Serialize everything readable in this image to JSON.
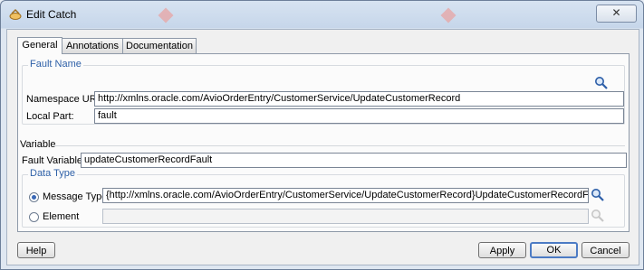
{
  "window": {
    "title": "Edit Catch",
    "close_glyph": "✕"
  },
  "tabs": [
    {
      "label": "General"
    },
    {
      "label": "Annotations"
    },
    {
      "label": "Documentation"
    }
  ],
  "fault_name": {
    "group_label": "Fault Name",
    "namespace_label": "Namespace URI:",
    "namespace_value": "http://xmlns.oracle.com/AvioOrderEntry/CustomerService/UpdateCustomerRecord",
    "local_part_label": "Local Part:",
    "local_part_value": "fault",
    "browse_icon": "search-icon"
  },
  "variable": {
    "section_label": "Variable",
    "fault_variable_label": "Fault Variable:",
    "fault_variable_value": "updateCustomerRecordFault"
  },
  "data_type": {
    "group_label": "Data Type",
    "message_type_label": "Message Type",
    "message_type_value": "{http://xmlns.oracle.com/AvioOrderEntry/CustomerService/UpdateCustomerRecord}UpdateCustomerRecordFaultMessage",
    "element_label": "Element",
    "element_value": "",
    "selected": "message_type"
  },
  "buttons": {
    "help": "Help",
    "apply": "Apply",
    "ok": "OK",
    "cancel": "Cancel"
  },
  "colors": {
    "group_label": "#2f61a8",
    "accent_border": "#4c7bc4"
  }
}
